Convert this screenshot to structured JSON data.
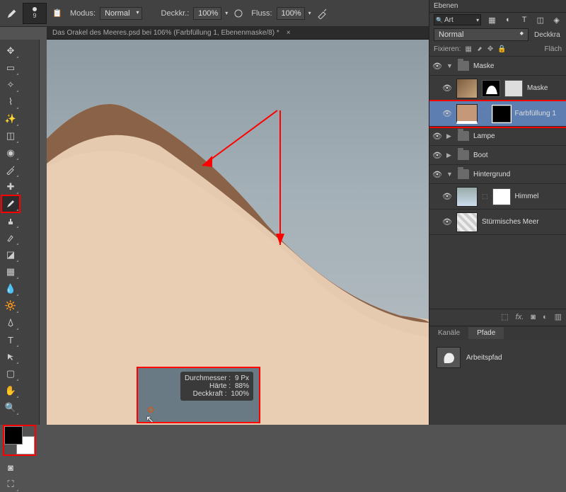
{
  "topbar": {
    "brush_size": "9",
    "mode_label": "Modus:",
    "mode_value": "Normal",
    "opacity_label": "Deckkr.:",
    "opacity_value": "100%",
    "flow_label": "Fluss:",
    "flow_value": "100%"
  },
  "panel_title": "Ebenen",
  "document_tab": "Das Orakel des Meeres.psd bei 106%  (Farbfüllung 1, Ebenenmaske/8) *",
  "brush_info": {
    "diameter_label": "Durchmesser :",
    "diameter_value": "9 Px",
    "hardness_label": "Härte :",
    "hardness_value": "88%",
    "opacity_label": "Deckkraft :",
    "opacity_value": "100%"
  },
  "right": {
    "search_value": "Art",
    "blend_mode": "Normal",
    "fill_label": "Deckkra",
    "lock_label": "Fixieren:",
    "flach_label": "Fläch"
  },
  "layers": {
    "group_maske": "Maske",
    "layer_maske": "Maske",
    "layer_farb": "Farbfüllung 1",
    "group_lampe": "Lampe",
    "group_boot": "Boot",
    "group_hg": "Hintergrund",
    "layer_himmel": "Himmel",
    "layer_meer": "Stürmisches Meer"
  },
  "paths": {
    "tab_kanale": "Kanäle",
    "tab_pfade": "Pfade",
    "arbeitspfad": "Arbeitspfad"
  },
  "icons": {
    "fx": "fx."
  },
  "colors": {
    "brown_dark": "#8a6247",
    "sand": "#e8ccb0",
    "fill_swatch": "#c49878"
  }
}
